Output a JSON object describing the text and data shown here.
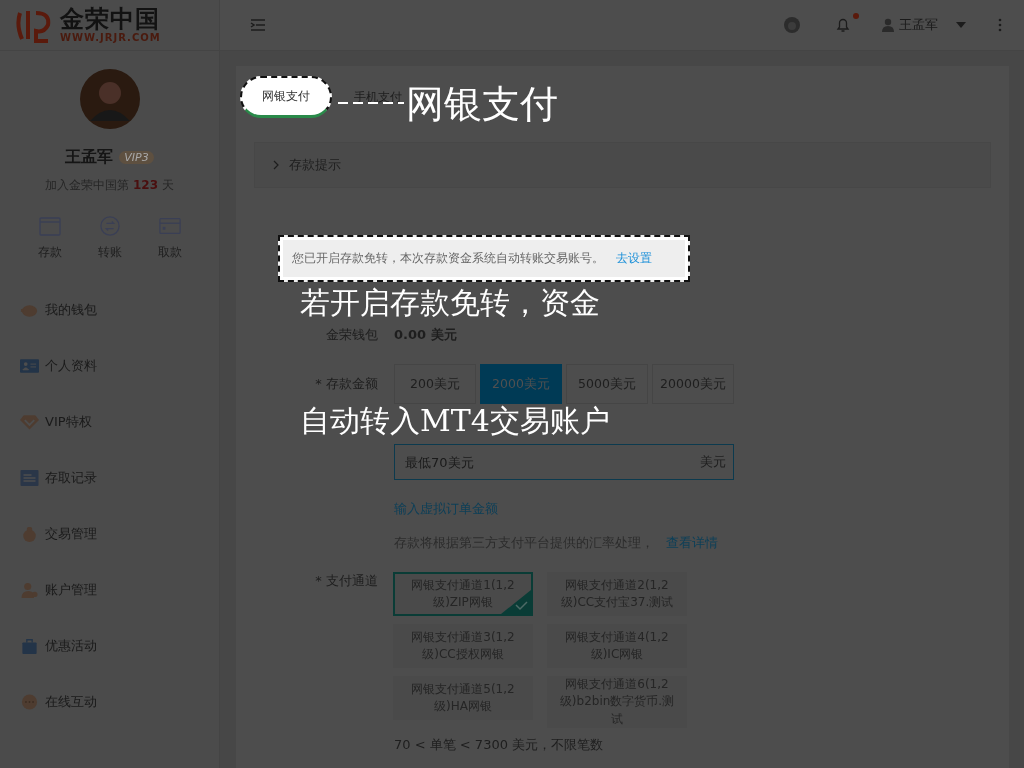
{
  "header": {
    "logo_name": "金荣中国",
    "logo_url": "WWW.JRJR.COM",
    "user_name": "王孟军",
    "has_notification": true
  },
  "profile": {
    "name": "王孟军",
    "vip": "VIP3",
    "joined_prefix": "加入金荣中国第",
    "joined_days": "123",
    "joined_suffix": "天"
  },
  "quick_actions": [
    {
      "label": "存款"
    },
    {
      "label": "转账"
    },
    {
      "label": "取款"
    }
  ],
  "menu": [
    {
      "label": "我的钱包"
    },
    {
      "label": "个人资料"
    },
    {
      "label": "VIP特权"
    },
    {
      "label": "存取记录"
    },
    {
      "label": "交易管理"
    },
    {
      "label": "账户管理"
    },
    {
      "label": "优惠活动"
    },
    {
      "label": "在线互动"
    }
  ],
  "tabs": [
    {
      "label": "网银支付",
      "selected": true
    },
    {
      "label": "手机支付",
      "selected": false
    }
  ],
  "deposit_tip": "存款提示",
  "notice": {
    "text": "您已开启存款免转，本次存款资金系统自动转账交易账号。",
    "link": "去设置"
  },
  "wallet": {
    "label": "金荣钱包",
    "amount": "0.00 美元"
  },
  "amount": {
    "label": "* 存款金额",
    "options": [
      {
        "label": "200美元",
        "selected": false
      },
      {
        "label": "2000美元",
        "selected": true
      },
      {
        "label": "5000美元",
        "selected": false
      },
      {
        "label": "20000美元",
        "selected": false
      }
    ],
    "placeholder": "最低70美元",
    "unit": "美元",
    "virtual_link": "输入虚拟订单金额"
  },
  "rate_note": {
    "text": "存款将根据第三方支付平台提供的汇率处理，",
    "link": "查看详情"
  },
  "channels": {
    "label": "* 支付通道",
    "options": [
      {
        "label": "网银支付通道1(1,2级)ZIP网银",
        "selected": true
      },
      {
        "label": "网银支付通道2(1,2级)CC支付宝37.测试",
        "selected": false
      },
      {
        "label": "网银支付通道3(1,2级)CC授权网银",
        "selected": false
      },
      {
        "label": "网银支付通道4(1,2级)IC网银",
        "selected": false
      },
      {
        "label": "网银支付通道5(1,2级)HA网银",
        "selected": false
      },
      {
        "label": "网银支付通道6(1,2级)b2bin数字货币.测试",
        "selected": false
      }
    ]
  },
  "limit": "70 < 单笔 < 7300 美元，不限笔数",
  "annotations": [
    "网银支付",
    "若开启存款免转，资金",
    "自动转入MT4交易账户"
  ]
}
